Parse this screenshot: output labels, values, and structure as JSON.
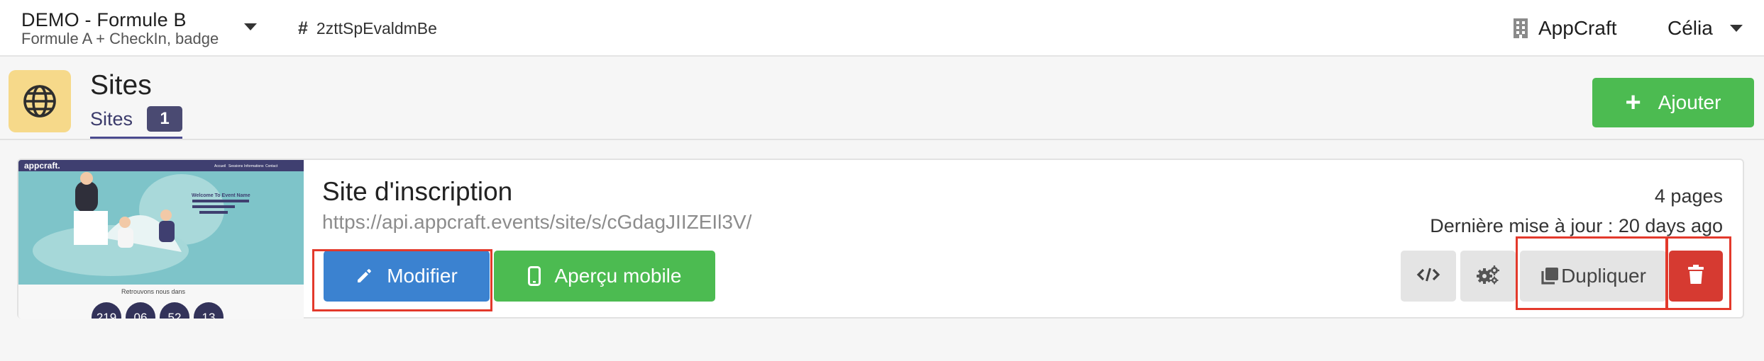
{
  "topbar": {
    "event_name": "DEMO - Formule B",
    "event_subtitle": "Formule A + CheckIn, badge",
    "event_id": "2zttSpEvaldmBe",
    "organization": "AppCraft",
    "user_name": "Célia"
  },
  "page": {
    "title": "Sites",
    "tab_label": "Sites",
    "tab_count": "1",
    "add_button": "Ajouter"
  },
  "site": {
    "title": "Site d'inscription",
    "url": "https://api.appcraft.events/site/s/cGdagJIIZEIl3V/",
    "pages": "4 pages",
    "updated": "Dernière mise à jour : 20 days ago",
    "edit_button": "Modifier",
    "preview_button": "Aperçu mobile",
    "duplicate_button": "Dupliquer",
    "thumbnail": {
      "brand": "appcraft.",
      "nav": [
        "Accueil",
        "Sessions",
        "Informations",
        "Contact"
      ],
      "hero_text": "Welcome To Event Name",
      "countdown_title": "Retrouvons nous dans",
      "countdown": [
        "219",
        "06",
        "52",
        "13"
      ]
    }
  },
  "colors": {
    "primary": "#3b82d0",
    "success": "#4cbb51",
    "danger": "#d63a31",
    "badge": "#4a4a72",
    "highlight": "#e3392b",
    "icon_bg": "#f6d98a"
  }
}
